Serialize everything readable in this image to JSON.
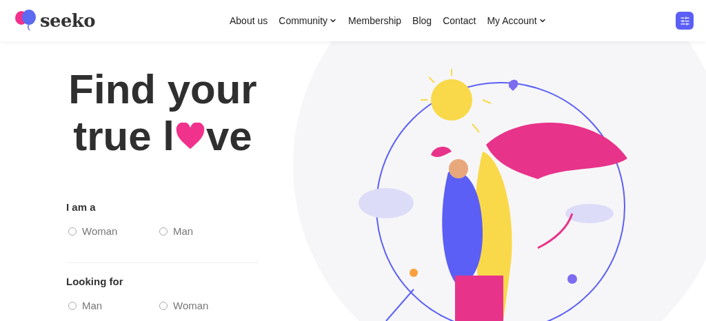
{
  "brand": {
    "name": "seeko"
  },
  "nav": [
    {
      "label": "About us",
      "dropdown": false
    },
    {
      "label": "Community",
      "dropdown": true
    },
    {
      "label": "Membership",
      "dropdown": false
    },
    {
      "label": "Blog",
      "dropdown": false
    },
    {
      "label": "Contact",
      "dropdown": false
    },
    {
      "label": "My Account",
      "dropdown": true
    }
  ],
  "hero": {
    "title_line_1": "Find your",
    "title_line_2_start": "true l",
    "title_line_2_end": "ve"
  },
  "groups": [
    {
      "label": "I am a",
      "options": [
        {
          "label": "Woman",
          "selected": false
        },
        {
          "label": "Man",
          "selected": false
        }
      ]
    },
    {
      "label": "Looking for",
      "options": [
        {
          "label": "Man",
          "selected": false
        },
        {
          "label": "Woman",
          "selected": false
        }
      ]
    }
  ]
}
